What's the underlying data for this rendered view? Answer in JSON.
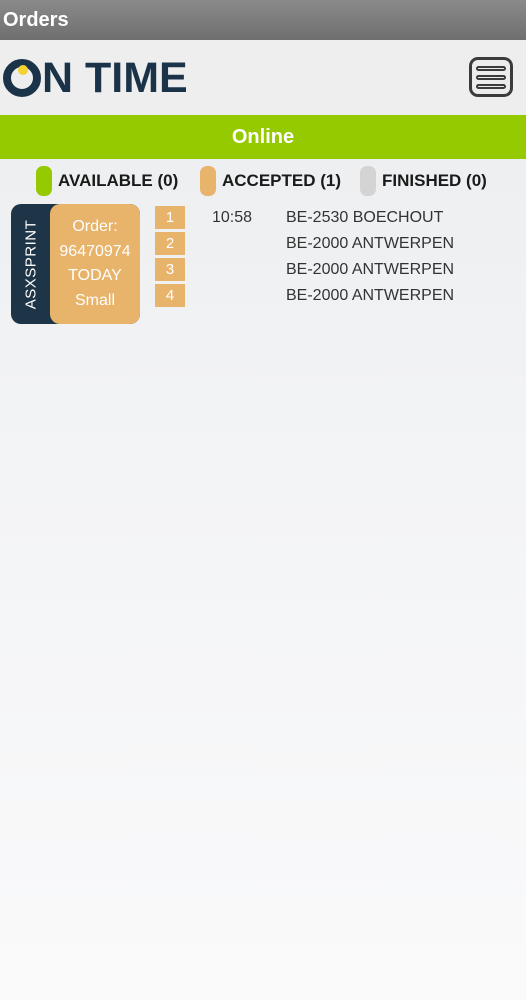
{
  "window": {
    "title": "Orders"
  },
  "header": {
    "logo_text": "N TIME"
  },
  "status": {
    "label": "Online",
    "color": "#95c900"
  },
  "legend": [
    {
      "label": "AVAILABLE (0)",
      "color": "#95c900"
    },
    {
      "label": "ACCEPTED (1)",
      "color": "#e8b36a"
    },
    {
      "label": "FINISHED (0)",
      "color": "#d4d4d4"
    }
  ],
  "orders": [
    {
      "vendor": "ASXSPRINT",
      "order_label": "Order:",
      "order_number": "96470974",
      "day": "TODAY",
      "size": "Small",
      "time": "10:58",
      "stops": [
        {
          "number": "1",
          "address": "BE-2530 BOECHOUT"
        },
        {
          "number": "2",
          "address": "BE-2000 ANTWERPEN"
        },
        {
          "number": "3",
          "address": "BE-2000 ANTWERPEN"
        },
        {
          "number": "4",
          "address": "BE-2000 ANTWERPEN"
        }
      ]
    }
  ]
}
